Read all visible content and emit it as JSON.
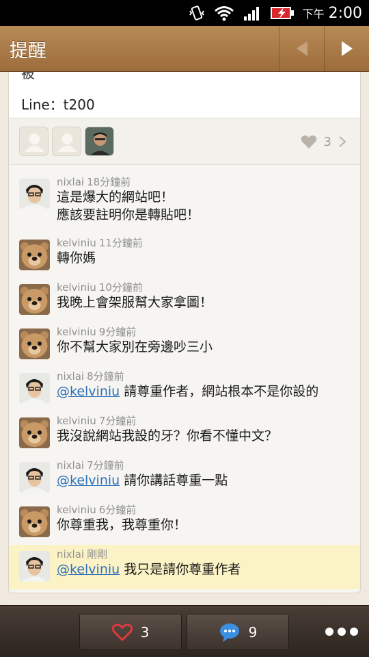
{
  "status_bar": {
    "ampm": "下午",
    "time": "2:00"
  },
  "header": {
    "title": "提醒"
  },
  "post": {
    "cut_text": "被",
    "line_text": "Line：t200"
  },
  "likes": {
    "count": "3"
  },
  "comments": [
    {
      "user": "nixlai",
      "avatar": "man",
      "time": "18分鐘前",
      "mention": "",
      "lines": [
        "這是爆大的網站吧！",
        "應該要註明你是轉貼吧！"
      ],
      "highlight": false
    },
    {
      "user": "kelviniu",
      "avatar": "bear",
      "time": "11分鐘前",
      "mention": "",
      "lines": [
        "轉你媽"
      ],
      "highlight": false
    },
    {
      "user": "kelviniu",
      "avatar": "bear",
      "time": "10分鐘前",
      "mention": "",
      "lines": [
        "我晚上會架服幫大家拿圖！"
      ],
      "highlight": false
    },
    {
      "user": "kelviniu",
      "avatar": "bear",
      "time": "9分鐘前",
      "mention": "",
      "lines": [
        "你不幫大家別在旁邊吵三小"
      ],
      "highlight": false
    },
    {
      "user": "nixlai",
      "avatar": "man",
      "time": "8分鐘前",
      "mention": "@kelviniu",
      "lines": [
        "請尊重作者，網站根本不是你設的"
      ],
      "highlight": false
    },
    {
      "user": "kelviniu",
      "avatar": "bear",
      "time": "7分鐘前",
      "mention": "",
      "lines": [
        "我沒說網站我設的牙？你看不懂中文？"
      ],
      "highlight": false
    },
    {
      "user": "nixlai",
      "avatar": "man",
      "time": "7分鐘前",
      "mention": "@kelviniu",
      "lines": [
        "請你講話尊重一點"
      ],
      "highlight": false
    },
    {
      "user": "kelviniu",
      "avatar": "bear",
      "time": "6分鐘前",
      "mention": "",
      "lines": [
        "你尊重我，我尊重你！"
      ],
      "highlight": false
    },
    {
      "user": "nixlai",
      "avatar": "man",
      "time": "剛剛",
      "mention": "@kelviniu",
      "lines": [
        "我只是請你尊重作者"
      ],
      "highlight": true
    }
  ],
  "bottom_bar": {
    "like_count": "3",
    "comment_count": "9"
  },
  "colors": {
    "accent_brown": "#a97a46",
    "mention_blue": "#2d6fb8",
    "highlight": "#fbf3c6",
    "heart_red": "#d8262b"
  }
}
